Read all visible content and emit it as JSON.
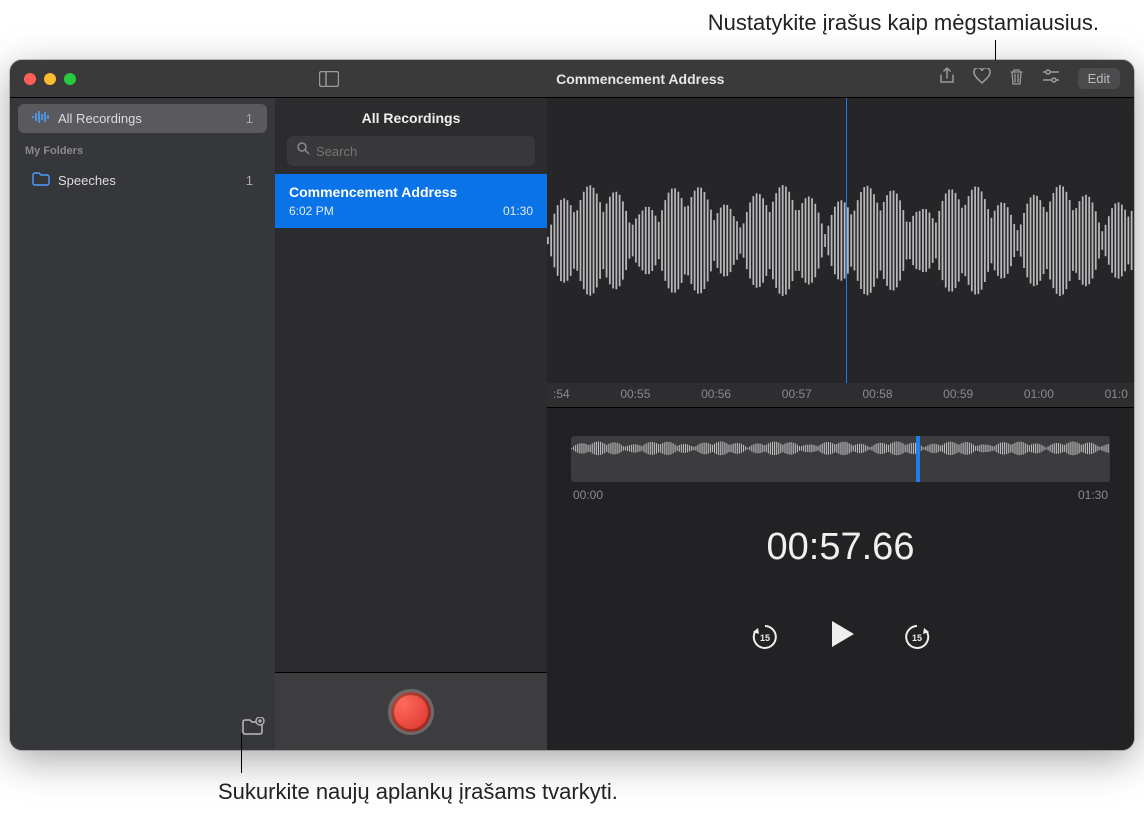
{
  "annotations": {
    "top": "Nustatykite įrašus kaip mėgstamiausius.",
    "bottom": "Sukurkite naujų aplankų įrašams tvarkyti."
  },
  "window": {
    "title": "Commencement Address",
    "toolbar": {
      "edit_label": "Edit"
    }
  },
  "sidebar": {
    "all_recordings_label": "All Recordings",
    "all_recordings_count": "1",
    "my_folders_header": "My Folders",
    "folders": [
      {
        "label": "Speeches",
        "count": "1"
      }
    ]
  },
  "recordings_list": {
    "header": "All Recordings",
    "search_placeholder": "Search",
    "items": [
      {
        "title": "Commencement Address",
        "time": "6:02 PM",
        "duration": "01:30"
      }
    ]
  },
  "player": {
    "ruler": [
      ":54",
      "00:55",
      "00:56",
      "00:57",
      "00:58",
      "00:59",
      "01:00",
      "01:0"
    ],
    "overview_start": "00:00",
    "overview_end": "01:30",
    "current_time": "00:57.66",
    "skip_seconds": "15",
    "playhead_percent": 51,
    "overview_playhead_percent": 64
  },
  "colors": {
    "accent": "#0a73e8",
    "red": "#ff5f57",
    "yellow": "#febc2e",
    "green": "#28c840"
  }
}
